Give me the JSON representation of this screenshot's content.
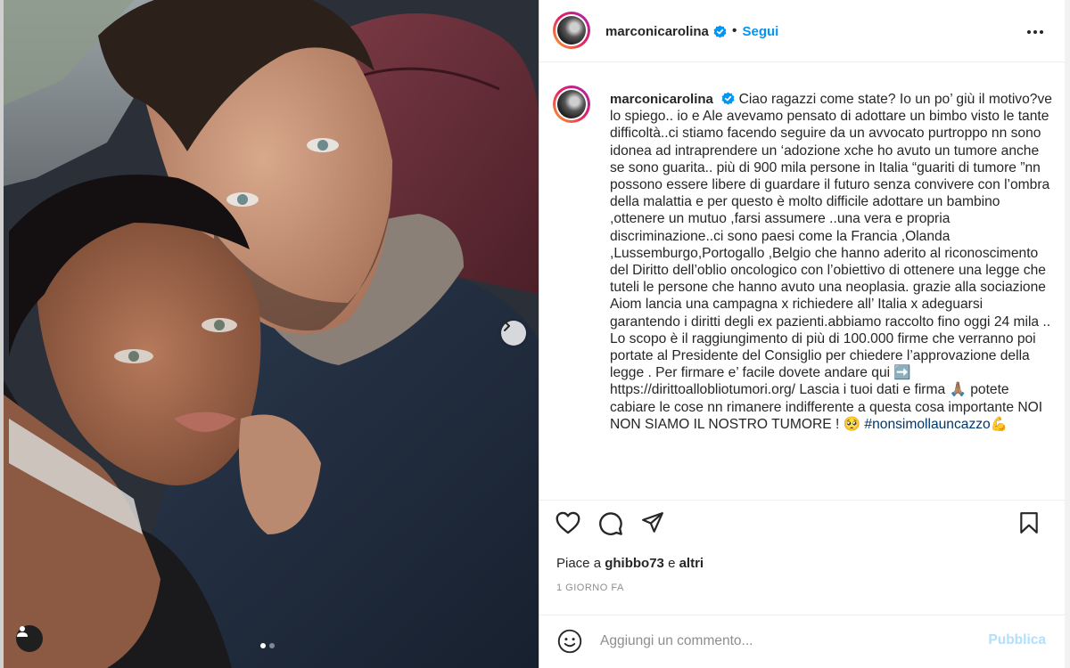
{
  "post": {
    "username": "marconicarolina",
    "follow_label": "Segui",
    "caption_user": "marconicarolina",
    "caption_text": "Ciao ragazzi come state? Io un po’ giù il motivo?ve lo spiego.. io e Ale avevamo pensato di adottare un bimbo visto le tante difficoltà..ci stiamo facendo seguire da un avvocato purtroppo nn sono idonea ad intraprendere un ‘adozione xche ho avuto un tumore anche se sono guarita.. più di 900 mila persone in Italia “guariti di tumore ”nn possono essere libere di guardare il futuro senza convivere con l’ombra della malattia e per questo è molto difficile adottare un bambino ,ottenere un mutuo ,farsi assumere ..una vera e propria discriminazione..ci sono paesi come la Francia ,Olanda ,Lussemburgo,Portogallo ,Belgio che hanno aderito al riconoscimento del Diritto dell’oblio oncologico con l’obiettivo di ottenere una legge che tuteli le persone che hanno avuto una neoplasia. grazie alla sociazione Aiom lancia una campagna x richiedere all’ Italia x adeguarsi garantendo i diritti degli ex pazienti.abbiamo raccolto fino oggi 24 mila .. Lo scopo è il raggiungimento di più di 100.000 firme che verranno poi portate al Presidente del Consiglio per chiedere l’approvazione della legge . Per firmare e’ facile dovete andare qui ➡️ https://dirittoallobliotumori.org/ Lascia i tuoi dati e firma 🙏🏽 potete cabiare le cose nn rimanere indifferente a questa cosa importante NOI NON SIAMO IL NOSTRO TUMORE ! 🥺",
    "hashtag": "#nonsimollauncazzo",
    "hashtag_emoji": "💪",
    "likes_prefix": "Piace a",
    "likes_user": "ghibbo73",
    "likes_and": "e",
    "likes_others": "altri",
    "timestamp": "1 GIORNO FA",
    "comment_placeholder": "Aggiungi un commento...",
    "publish_label": "Pubblica"
  },
  "colors": {
    "accent": "#0095f6",
    "publish_disabled": "#b2dffc",
    "verified": "#0095f6"
  },
  "icons": [
    "more-options-icon",
    "verified-badge-icon",
    "heart-icon",
    "comment-icon",
    "share-icon",
    "bookmark-icon",
    "emoji-icon",
    "chevron-right-icon",
    "user-tag-icon"
  ],
  "carousel": {
    "slides": 2,
    "current": 1
  }
}
